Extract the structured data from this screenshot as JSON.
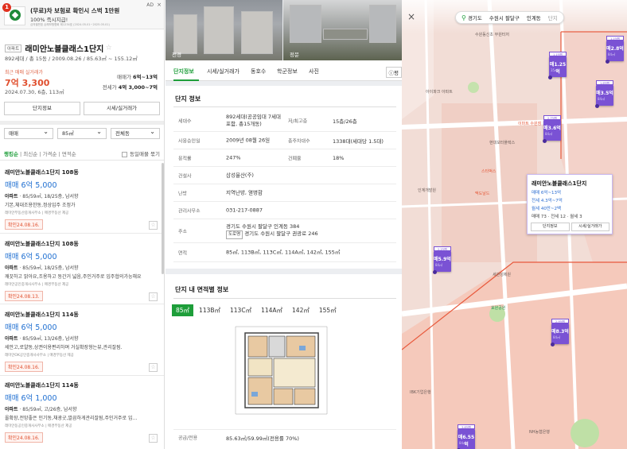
{
  "ad": {
    "badge": "1",
    "title": "(무료)차 보험료 확인시 스벅 1만원",
    "subtitle": "100% 즉시지급!",
    "fine_print": "심의필번호 손해보험협회 제1234호 (2024.05.01~2025.05.01)",
    "tag": "AD",
    "close": "×"
  },
  "complex": {
    "badge": "아파트",
    "name": "래미안노블클래스1단지",
    "star": "☆",
    "spec": "892세대 / 총 15동 / 2009.08.26 / 85.63㎡ ~ 155.12㎡",
    "recent_label": "최근 매매 실거래가",
    "recent_price": "7억 3,300",
    "recent_date": "2024.07.30, 6층, 113㎡",
    "sale_range_label": "매매가",
    "sale_range": "6억~13억",
    "jeonse_range_label": "전세가",
    "jeonse_range": "4억 3,000~7억",
    "btn_info": "단지정보",
    "btn_price": "시세/실거래가"
  },
  "filters": {
    "type": "매매",
    "size": "85㎡",
    "dong": "전체동"
  },
  "sort": {
    "items": [
      "랭킹순",
      "최신순",
      "가격순",
      "면적순"
    ],
    "group_label": "동일매물 묶기"
  },
  "listings": [
    {
      "name": "래미안노블클래스1단지 108동",
      "price": "매매 6억 5,000",
      "type": "아파트",
      "spec": " · 85/59㎡, 18/25층, 남서향",
      "desc": "기본,체대조용한동,정상입주 조정가",
      "realtor": "래미안부동산중개사무소 | 매경부동산 제공",
      "confirm": "확인24.08.16.",
      "fav": "☆"
    },
    {
      "name": "래미안노블클래스1단지 108동",
      "price": "매매 6억 5,000",
      "type": "아파트",
      "spec": " · 85/59㎡, 18/25층, 남서향",
      "desc": "깨끗하고 밝아요,조용하고 동간거 넓음,주인거주로 입주협의가능해요",
      "realtor": "래미안공인중개사사무소 | 매경부동산 제공",
      "confirm": "확인24.08.13.",
      "fav": "☆"
    },
    {
      "name": "래미안노블클래스1단지 114동",
      "price": "매매 6억 5,000",
      "type": "아파트",
      "spec": " · 85/59㎡, 13/26층, 남서향",
      "desc": "세안고,로얄동,상권이용편리하며 거실확장형는뷰,관리잘됨.",
      "realtor": "래미안OK공인중개사사무소 | 매경부동산 제공",
      "confirm": "확인24.08.16.",
      "fav": "☆"
    },
    {
      "name": "래미안노블클래스1단지 114동",
      "price": "매매 6억 1,000",
      "type": "아파트",
      "spec": " · 85/59㎡, 고/26층, 남서향",
      "desc": "올확장,전망좋은 인기동,채광굿,깔끔하게관리잘됨,주인거주로 입…",
      "realtor": "래미안동공인중개사사무소 | 매경부동산 제공",
      "confirm": "확인24.08.16.",
      "fav": "☆"
    }
  ],
  "photos": [
    "전경",
    "정문"
  ],
  "tabs": [
    "단지정보",
    "시세/실거래가",
    "동호수",
    "학군정보",
    "사진"
  ],
  "tab_more": "ⓘ평",
  "info": {
    "title": "단지 정보",
    "rows": [
      {
        "k": "세대수",
        "v": "892세대(공공임대 7세대 포함, 총15개동)",
        "k2": "저/최고층",
        "v2": "15층/26층"
      },
      {
        "k": "사용승인일",
        "v": "2009년 08월 26일",
        "k2": "총주차대수",
        "v2": "1338대(세대당 1.5대)"
      },
      {
        "k": "용적률",
        "v": "247%",
        "k2": "건폐율",
        "v2": "18%"
      },
      {
        "k": "건설사",
        "v": "삼성물산(주)"
      },
      {
        "k": "난방",
        "v": "지역난방, 열병합"
      },
      {
        "k": "관리사무소",
        "v": "031-217-0887"
      },
      {
        "k": "주소",
        "v": "경기도 수원시 팔달구 인계동 384",
        "tag": "도로명",
        "v3": "경기도 수원시 팔달구 권광로 246"
      },
      {
        "k": "면적",
        "v": "85㎡, 113B㎡, 113C㎡, 114A㎡, 142㎡, 155㎡"
      }
    ]
  },
  "plan": {
    "title": "단지 내 면적별 정보",
    "sizes": [
      "85㎡",
      "113B㎡",
      "113C㎡",
      "114A㎡",
      "142㎡",
      "155㎡"
    ],
    "area_label": "공급/전용",
    "area_value": "85.63㎡/59.99㎡(전용률 70%)"
  },
  "map": {
    "close": "×",
    "breadcrumb": [
      "경기도",
      "수원시 팔달구",
      "인계동",
      "단지"
    ],
    "markers": [
      {
        "top": "1.1억원",
        "price": "매1.25억",
        "sub": "35㎡"
      },
      {
        "top": "1.1억원",
        "price": "매2.8억",
        "sub": "84㎡"
      },
      {
        "top": "1.6억원",
        "price": "매3.5억",
        "sub": "84㎡"
      },
      {
        "top": "2.7억원",
        "price": "매3.6억",
        "sub": "84㎡"
      },
      {
        "top": "2.2억원",
        "price": "매5.9억",
        "sub": "84㎡"
      },
      {
        "top": "2.9억원",
        "price": "매8.3억",
        "sub": "84㎡"
      },
      {
        "top": "3.6억원",
        "price": "매6.55억",
        "sub": "84㎡"
      }
    ],
    "popup": {
      "title": "래미안노블클래스1단지",
      "sale": "매매 6억~13억",
      "jeonse": "전세 4.3억~7억",
      "rent": "월세 40만~2백",
      "counts": "매매 73 · 전세 12 · 월세 3",
      "btn1": "단지정보",
      "btn2": "시세/실거래가"
    },
    "labels": [
      "수원제일교회",
      "수원동신초 무원터저",
      "아이파크 아파트",
      "수원시청",
      "이마트 수원점",
      "인계팀플 아파트",
      "현대모터플렉스",
      "아이파크3차",
      "인계개발원",
      "스타벅스",
      "맥도날드",
      "래미안노블클래스1단지아파트",
      "래미안노블클래스2단지아파트",
      "세관성제원",
      "IBK기업은행",
      "국민은행",
      "NH농협은행",
      "이마트24",
      "효원공원"
    ]
  }
}
